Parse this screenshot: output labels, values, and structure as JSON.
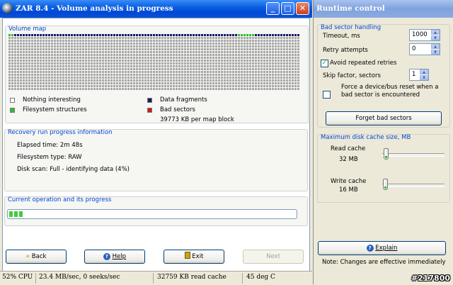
{
  "main_window": {
    "title": "ZAR 8.4 - Volume analysis in progress",
    "minimize_glyph": "_",
    "maximize_glyph": "□",
    "close_glyph": "✕"
  },
  "volume_map": {
    "label": "Volume map",
    "legend": {
      "nothing_interesting": "Nothing interesting",
      "filesystem_structures": "Filesystem structures",
      "data_fragments": "Data fragments",
      "bad_sectors": "Bad sectors",
      "block_size": "39773 KB per map block"
    },
    "colors": {
      "empty": "#ffffff",
      "filesystem": "#2fbf2f",
      "data": "#1a1a6a",
      "bad": "#d01818",
      "unscanned": "#a8a8a8"
    }
  },
  "recovery_info": {
    "label": "Recovery run progress information",
    "elapsed": "Elapsed time: 2m 48s",
    "filesystem": "Filesystem type: RAW",
    "disk_scan": "Disk scan: Full - identifying data (4%)"
  },
  "current_op": {
    "label": "Current operation and its progress",
    "progress_fraction": 0.04
  },
  "nav_buttons": {
    "back": "Back",
    "help": "Help",
    "exit": "Exit",
    "next": "Next"
  },
  "status_bar": {
    "cpu": "52% CPU",
    "speed": "23.4 MB/sec, 0 seeks/sec",
    "cache": "32759 KB read cache",
    "temp": "45 deg C"
  },
  "runtime_window": {
    "title": "Runtime control",
    "bad_sector_label": "Bad sector handling",
    "timeout_label": "Timeout, ms",
    "timeout_value": "1000",
    "retry_label": "Retry attempts",
    "retry_value": "0",
    "avoid_label": "Avoid repeated retries",
    "avoid_checked": true,
    "skip_label": "Skip factor, sectors",
    "skip_value": "1",
    "force_label_1": "Force a device/bus reset when a",
    "force_label_2": "bad sector is encountered",
    "force_checked": false,
    "forget_button": "Forget bad sectors",
    "cache_label": "Maximum disk cache size, MB",
    "read_cache_label": "Read cache",
    "read_cache_value": "32 MB",
    "read_cache_fraction": 0.03,
    "write_cache_label": "Write cache",
    "write_cache_value": "16 MB",
    "write_cache_fraction": 0.01,
    "explain_button": "Explain",
    "note": "Note: Changes are effective immediately"
  },
  "watermark": "#217800"
}
